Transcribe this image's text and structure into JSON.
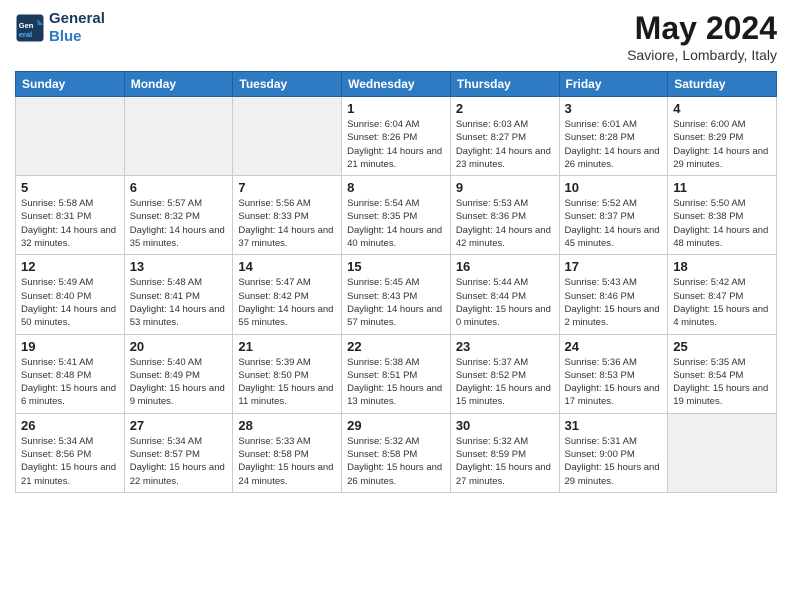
{
  "header": {
    "logo_line1": "General",
    "logo_line2": "Blue",
    "month_title": "May 2024",
    "location": "Saviore, Lombardy, Italy"
  },
  "weekdays": [
    "Sunday",
    "Monday",
    "Tuesday",
    "Wednesday",
    "Thursday",
    "Friday",
    "Saturday"
  ],
  "weeks": [
    [
      {
        "day": "",
        "empty": true
      },
      {
        "day": "",
        "empty": true
      },
      {
        "day": "",
        "empty": true
      },
      {
        "day": "1",
        "info": "Sunrise: 6:04 AM\nSunset: 8:26 PM\nDaylight: 14 hours\nand 21 minutes."
      },
      {
        "day": "2",
        "info": "Sunrise: 6:03 AM\nSunset: 8:27 PM\nDaylight: 14 hours\nand 23 minutes."
      },
      {
        "day": "3",
        "info": "Sunrise: 6:01 AM\nSunset: 8:28 PM\nDaylight: 14 hours\nand 26 minutes."
      },
      {
        "day": "4",
        "info": "Sunrise: 6:00 AM\nSunset: 8:29 PM\nDaylight: 14 hours\nand 29 minutes."
      }
    ],
    [
      {
        "day": "5",
        "info": "Sunrise: 5:58 AM\nSunset: 8:31 PM\nDaylight: 14 hours\nand 32 minutes."
      },
      {
        "day": "6",
        "info": "Sunrise: 5:57 AM\nSunset: 8:32 PM\nDaylight: 14 hours\nand 35 minutes."
      },
      {
        "day": "7",
        "info": "Sunrise: 5:56 AM\nSunset: 8:33 PM\nDaylight: 14 hours\nand 37 minutes."
      },
      {
        "day": "8",
        "info": "Sunrise: 5:54 AM\nSunset: 8:35 PM\nDaylight: 14 hours\nand 40 minutes."
      },
      {
        "day": "9",
        "info": "Sunrise: 5:53 AM\nSunset: 8:36 PM\nDaylight: 14 hours\nand 42 minutes."
      },
      {
        "day": "10",
        "info": "Sunrise: 5:52 AM\nSunset: 8:37 PM\nDaylight: 14 hours\nand 45 minutes."
      },
      {
        "day": "11",
        "info": "Sunrise: 5:50 AM\nSunset: 8:38 PM\nDaylight: 14 hours\nand 48 minutes."
      }
    ],
    [
      {
        "day": "12",
        "info": "Sunrise: 5:49 AM\nSunset: 8:40 PM\nDaylight: 14 hours\nand 50 minutes."
      },
      {
        "day": "13",
        "info": "Sunrise: 5:48 AM\nSunset: 8:41 PM\nDaylight: 14 hours\nand 53 minutes."
      },
      {
        "day": "14",
        "info": "Sunrise: 5:47 AM\nSunset: 8:42 PM\nDaylight: 14 hours\nand 55 minutes."
      },
      {
        "day": "15",
        "info": "Sunrise: 5:45 AM\nSunset: 8:43 PM\nDaylight: 14 hours\nand 57 minutes."
      },
      {
        "day": "16",
        "info": "Sunrise: 5:44 AM\nSunset: 8:44 PM\nDaylight: 15 hours\nand 0 minutes."
      },
      {
        "day": "17",
        "info": "Sunrise: 5:43 AM\nSunset: 8:46 PM\nDaylight: 15 hours\nand 2 minutes."
      },
      {
        "day": "18",
        "info": "Sunrise: 5:42 AM\nSunset: 8:47 PM\nDaylight: 15 hours\nand 4 minutes."
      }
    ],
    [
      {
        "day": "19",
        "info": "Sunrise: 5:41 AM\nSunset: 8:48 PM\nDaylight: 15 hours\nand 6 minutes."
      },
      {
        "day": "20",
        "info": "Sunrise: 5:40 AM\nSunset: 8:49 PM\nDaylight: 15 hours\nand 9 minutes."
      },
      {
        "day": "21",
        "info": "Sunrise: 5:39 AM\nSunset: 8:50 PM\nDaylight: 15 hours\nand 11 minutes."
      },
      {
        "day": "22",
        "info": "Sunrise: 5:38 AM\nSunset: 8:51 PM\nDaylight: 15 hours\nand 13 minutes."
      },
      {
        "day": "23",
        "info": "Sunrise: 5:37 AM\nSunset: 8:52 PM\nDaylight: 15 hours\nand 15 minutes."
      },
      {
        "day": "24",
        "info": "Sunrise: 5:36 AM\nSunset: 8:53 PM\nDaylight: 15 hours\nand 17 minutes."
      },
      {
        "day": "25",
        "info": "Sunrise: 5:35 AM\nSunset: 8:54 PM\nDaylight: 15 hours\nand 19 minutes."
      }
    ],
    [
      {
        "day": "26",
        "info": "Sunrise: 5:34 AM\nSunset: 8:56 PM\nDaylight: 15 hours\nand 21 minutes."
      },
      {
        "day": "27",
        "info": "Sunrise: 5:34 AM\nSunset: 8:57 PM\nDaylight: 15 hours\nand 22 minutes."
      },
      {
        "day": "28",
        "info": "Sunrise: 5:33 AM\nSunset: 8:58 PM\nDaylight: 15 hours\nand 24 minutes."
      },
      {
        "day": "29",
        "info": "Sunrise: 5:32 AM\nSunset: 8:58 PM\nDaylight: 15 hours\nand 26 minutes."
      },
      {
        "day": "30",
        "info": "Sunrise: 5:32 AM\nSunset: 8:59 PM\nDaylight: 15 hours\nand 27 minutes."
      },
      {
        "day": "31",
        "info": "Sunrise: 5:31 AM\nSunset: 9:00 PM\nDaylight: 15 hours\nand 29 minutes."
      },
      {
        "day": "",
        "empty": true
      }
    ]
  ]
}
